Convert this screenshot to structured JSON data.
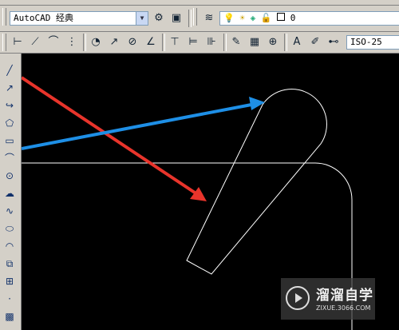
{
  "toolbar": {
    "workspace_combo": "AutoCAD 经典",
    "layer_combo": "0",
    "dimstyle_combo": "ISO-25"
  },
  "watermark": {
    "title": "溜溜自学",
    "subtitle": "ZIXUE.3066.COM"
  },
  "colors": {
    "arrow_red": "#e8342b",
    "arrow_blue": "#1e8fe6",
    "drawing_lines": "#ffffff",
    "canvas": "#000000",
    "toolbar": "#d4d0c8"
  },
  "icons": {
    "top_row": [
      "workspace-settings-icon",
      "layer-properties-icon",
      "layer-state-icon",
      "lightbulb-icon",
      "sun-icon",
      "lock-icon",
      "color-square-icon"
    ],
    "dim_row": [
      "linear-dim-icon",
      "aligned-dim-icon",
      "arc-length-icon",
      "ordinate-dim-icon",
      "radius-dim-icon",
      "jogged-dim-icon",
      "diameter-dim-icon",
      "angular-dim-icon",
      "quick-dim-icon",
      "baseline-dim-icon",
      "continue-dim-icon",
      "qleader-icon",
      "tolerance-icon",
      "center-mark-icon",
      "dimedit-icon",
      "dimtedit-icon",
      "dimstyle-icon"
    ],
    "draw_bar": [
      "line-icon",
      "construction-line-icon",
      "polyline-icon",
      "polygon-icon",
      "rectangle-icon",
      "arc-icon",
      "circle-icon",
      "revision-cloud-icon",
      "spline-icon",
      "ellipse-icon",
      "ellipse-arc-icon",
      "insert-block-icon",
      "make-block-icon",
      "point-icon",
      "hatch-icon"
    ]
  }
}
